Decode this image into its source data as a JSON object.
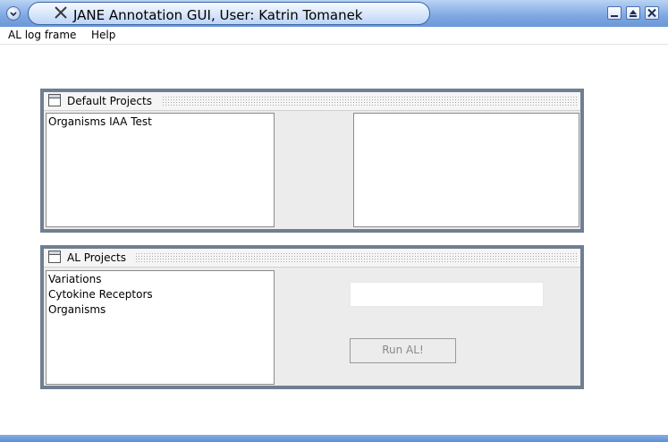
{
  "window": {
    "title": "JANE Annotation GUI, User: Katrin Tomanek",
    "icons": [
      "window-menu-icon",
      "app-icon",
      "minimize-icon",
      "maximize-icon",
      "close-icon"
    ]
  },
  "menubar": {
    "items": [
      "AL log frame",
      "Help"
    ]
  },
  "default_projects": {
    "title": "Default Projects",
    "list_items": [
      "Organisms IAA Test"
    ],
    "right_list_items": []
  },
  "al_projects": {
    "title": "AL Projects",
    "list_items": [
      "Variations",
      "Cytokine Receptors",
      "Organisms"
    ],
    "input_value": "",
    "run_button": "Run AL!"
  }
}
